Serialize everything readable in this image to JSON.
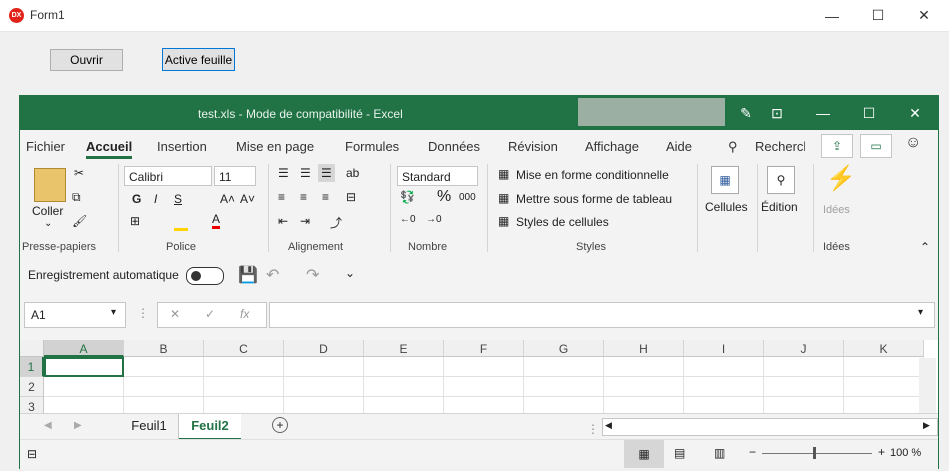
{
  "form": {
    "title": "Form1",
    "icon_text": "DX",
    "controls": {
      "minimize": "—",
      "maximize": "☐",
      "close": "✕"
    },
    "buttons": {
      "open": "Ouvrir",
      "active_sheet": "Active feuille"
    }
  },
  "excel": {
    "title": "test.xls  -  Mode de compatibilité  -  Excel",
    "tabs": [
      "Fichier",
      "Accueil",
      "Insertion",
      "Mise en page",
      "Formules",
      "Données",
      "Révision",
      "Affichage",
      "Aide"
    ],
    "search_label": "Recherch",
    "ribbon": {
      "clipboard": {
        "paste": "Coller",
        "label": "Presse-papiers"
      },
      "font": {
        "name": "Calibri",
        "size": "11",
        "label": "Police",
        "bold": "G",
        "italic": "I",
        "underline": "S",
        "grow": "A˄",
        "shrink": "A˅"
      },
      "alignment": {
        "label": "Alignement"
      },
      "number": {
        "format": "Standard",
        "label": "Nombre",
        "percent": "%",
        "thousands": "000"
      },
      "styles": {
        "conditional": "Mise en forme conditionnelle",
        "table": "Mettre sous forme de tableau",
        "cell_styles": "Styles de cellules",
        "label": "Styles"
      },
      "cells": {
        "label": "Cellules"
      },
      "editing": {
        "label": "Édition"
      },
      "ideas": {
        "label": "Idées",
        "group_label": "Idées"
      }
    },
    "qat": {
      "autosave": "Enregistrement automatique"
    },
    "formula_bar": {
      "name_box": "A1",
      "fx": "fx",
      "value": ""
    },
    "columns": [
      "A",
      "B",
      "C",
      "D",
      "E",
      "F",
      "G",
      "H",
      "I",
      "J",
      "K"
    ],
    "rows": [
      "1",
      "2",
      "3"
    ],
    "sheets": [
      "Feuil1",
      "Feuil2"
    ],
    "active_sheet": "Feuil2",
    "zoom": "100 %",
    "colors": {
      "brand": "#217346",
      "form_icon": "#e2231a"
    }
  }
}
